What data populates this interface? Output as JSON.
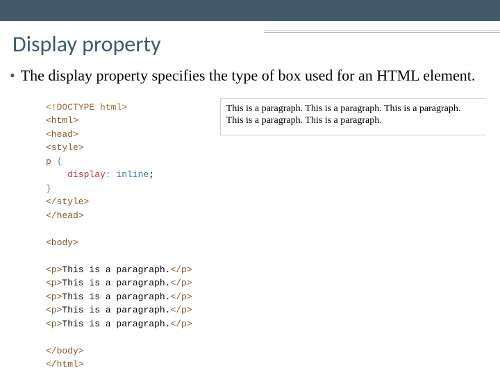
{
  "title": "Display property",
  "bullet": "The display property specifies the type of box used for an HTML element.",
  "code": {
    "doctype": "<!DOCTYPE html>",
    "html_open": "<html>",
    "head_open": "<head>",
    "style_open": "<style>",
    "selector": "p",
    "brace_open": " {",
    "prop_indent": "    ",
    "prop": "display",
    "colon": ": ",
    "val": "inline",
    "semi": ";",
    "brace_close": "}",
    "style_close": "</style>",
    "head_close": "</head>",
    "body_open": "<body>",
    "para_open": "<p>",
    "para_text": "This is a paragraph.",
    "para_close": "</p>",
    "body_close": "</body>",
    "html_close": "</html>"
  },
  "output": "This is a paragraph. This is a paragraph. This is a paragraph. This is a paragraph. This is a paragraph."
}
